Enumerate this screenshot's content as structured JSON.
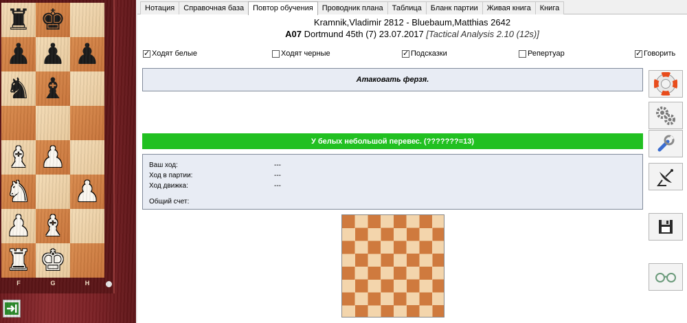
{
  "tabs": [
    "Нотация",
    "Справочная база",
    "Повтор обучения",
    "Проводник плана",
    "Таблица",
    "Бланк партии",
    "Живая книга",
    "Книга"
  ],
  "active_tab_index": 2,
  "game": {
    "white_player": "Kramnik,Vladimir",
    "white_elo": "2812",
    "separator": " - ",
    "black_player": "Bluebaum,Matthias",
    "black_elo": "2642",
    "eco": "A07",
    "event": " Dortmund 45th (7) 23.07.2017 ",
    "analysis": "[Tactical Analysis 2.10 (12s)]"
  },
  "options": [
    {
      "label": "Ходят белые",
      "checked": true
    },
    {
      "label": "Ходят черные",
      "checked": false
    },
    {
      "label": "Подсказки",
      "checked": true
    },
    {
      "label": "Репертуар",
      "checked": false
    },
    {
      "label": "Говорить",
      "checked": true
    }
  ],
  "hint": "Атаковать ферзя.",
  "evaluation": "У белых небольшой перевес. (???????=13)",
  "evaluation_color": "#21c021",
  "stats": {
    "your_move_label": "Ваш ход:",
    "your_move_value": "---",
    "game_move_label": "Ход в партии:",
    "game_move_value": "---",
    "engine_move_label": "Ход движка:",
    "engine_move_value": "---",
    "total_label": "Общий счет:"
  },
  "board": {
    "files": [
      "F",
      "G",
      "H"
    ],
    "rows": [
      [
        "black-rook",
        "black-king",
        ""
      ],
      [
        "black-pawn",
        "black-pawn",
        "black-pawn"
      ],
      [
        "black-knight",
        "black-bishop",
        ""
      ],
      [
        "",
        "",
        ""
      ],
      [
        "white-bishop",
        "white-pawn",
        ""
      ],
      [
        "white-knight",
        "",
        "white-pawn"
      ],
      [
        "white-pawn",
        "white-bishop",
        ""
      ],
      [
        "white-rook",
        "white-king",
        ""
      ]
    ]
  },
  "side_buttons": [
    "lifebuoy-icon",
    "gears-icon",
    "wrench-icon",
    "satellite-icon",
    "save-icon",
    "glasses-icon"
  ]
}
